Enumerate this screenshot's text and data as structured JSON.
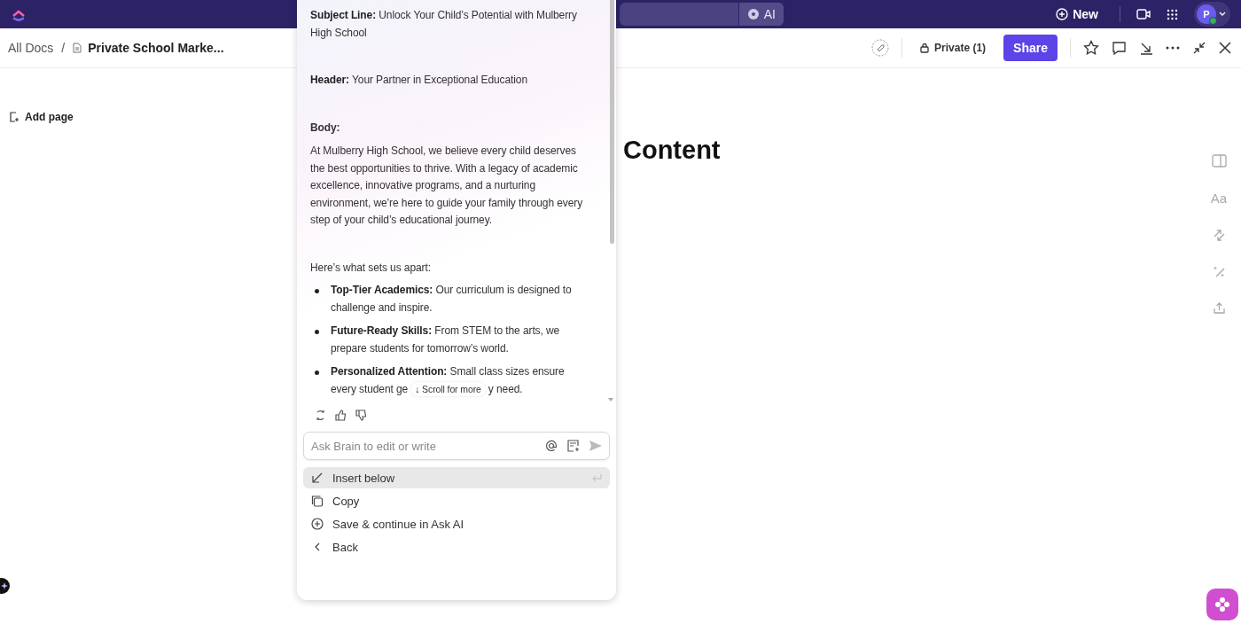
{
  "topbar": {
    "search_ai_button": "AI",
    "new_button": "New",
    "avatar": "P"
  },
  "breadcrumb": {
    "root": "All Docs",
    "separator": "/",
    "doc": "Private School Marke..."
  },
  "doc_actions": {
    "privacy": "Private (1)",
    "share": "Share"
  },
  "sidebar": {
    "add_page": "Add page"
  },
  "document": {
    "title_fragment": "Content"
  },
  "right_rail": {
    "text_style": "Aa"
  },
  "ai_panel": {
    "fields": [
      {
        "label": "Subject Line:",
        "text": "Unlock Your Child’s Potential with Mulberry High School"
      },
      {
        "label": "Header:",
        "text": "Your Partner in Exceptional Education"
      }
    ],
    "body_label": "Body:",
    "paragraphs": [
      "At Mulberry High School, we believe every child deserves the best opportunities to thrive. With a legacy of academic excellence, innovative programs, and a nurturing environment, we’re here to guide your family through every step of your child’s educational journey.",
      "Here’s what sets us apart:"
    ],
    "bullets": [
      {
        "bold": "Top-Tier Academics:",
        "text": "Our curriculum is designed to challenge and inspire."
      },
      {
        "bold": "Future-Ready Skills:",
        "text": "From STEM to the arts, we prepare students for tomorrow’s world."
      },
      {
        "bold": "Personalized Attention:",
        "text": "Small class sizes ensure every student ge",
        "tail": "y need."
      }
    ],
    "scroll_hint": "↓ Scroll for more",
    "prompt": {
      "placeholder": "Ask Brain to edit or write"
    },
    "actions": [
      {
        "kind": "insert",
        "label": "Insert below",
        "selected": true
      },
      {
        "kind": "copy",
        "label": "Copy",
        "selected": false
      },
      {
        "kind": "save",
        "label": "Save & continue in Ask AI",
        "selected": false
      },
      {
        "kind": "back",
        "label": "Back",
        "selected": false
      }
    ]
  }
}
